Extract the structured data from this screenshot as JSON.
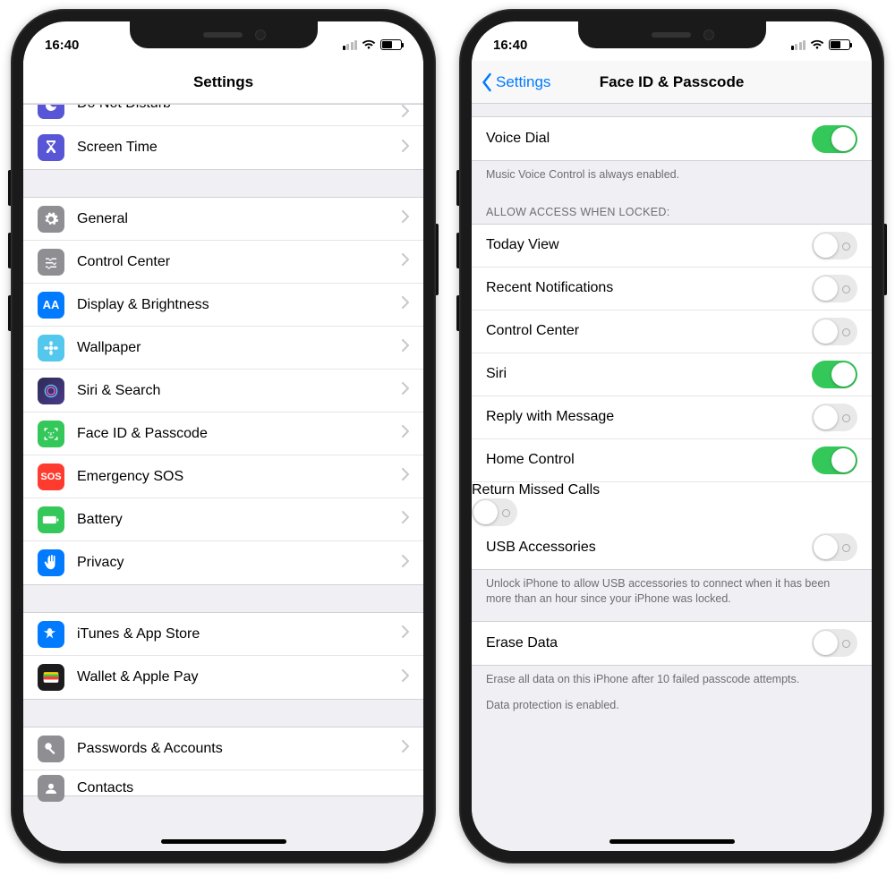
{
  "status": {
    "time": "16:40"
  },
  "left": {
    "title": "Settings",
    "rows": {
      "dnd": "Do Not Disturb",
      "screentime": "Screen Time",
      "general": "General",
      "control": "Control Center",
      "display": "Display & Brightness",
      "wallpaper": "Wallpaper",
      "siri": "Siri & Search",
      "faceid": "Face ID & Passcode",
      "sos": "Emergency SOS",
      "battery": "Battery",
      "privacy": "Privacy",
      "itunes": "iTunes & App Store",
      "wallet": "Wallet & Apple Pay",
      "passwords": "Passwords & Accounts",
      "contacts": "Contacts"
    },
    "sos_icon_text": "SOS"
  },
  "right": {
    "back": "Settings",
    "title": "Face ID & Passcode",
    "voice_dial": {
      "label": "Voice Dial",
      "footer": "Music Voice Control is always enabled.",
      "on": true
    },
    "allow_header": "ALLOW ACCESS WHEN LOCKED:",
    "toggles": {
      "today": {
        "label": "Today View",
        "on": false
      },
      "recent": {
        "label": "Recent Notifications",
        "on": false
      },
      "control": {
        "label": "Control Center",
        "on": false
      },
      "siri": {
        "label": "Siri",
        "on": true
      },
      "reply": {
        "label": "Reply with Message",
        "on": false
      },
      "home": {
        "label": "Home Control",
        "on": true
      },
      "missed": {
        "label": "Return Missed Calls",
        "on": false
      },
      "usb": {
        "label": "USB Accessories",
        "on": false
      }
    },
    "usb_footer": "Unlock iPhone to allow USB accessories to connect when it has been more than an hour since your iPhone was locked.",
    "erase": {
      "label": "Erase Data",
      "on": false
    },
    "erase_footer1": "Erase all data on this iPhone after 10 failed passcode attempts.",
    "erase_footer2": "Data protection is enabled."
  }
}
